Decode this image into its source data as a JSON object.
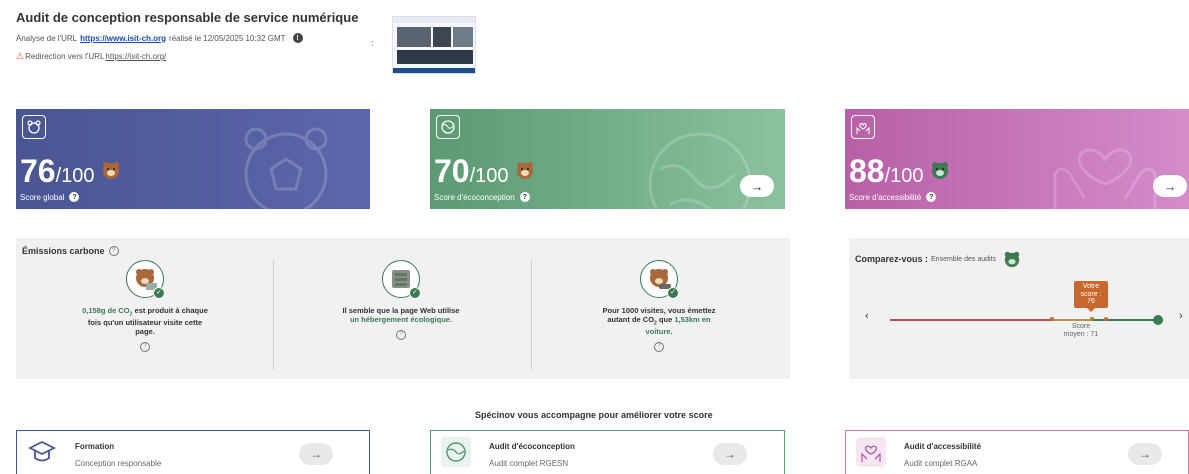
{
  "header": {
    "title": "Audit de conception responsable de service numérique",
    "meta_prefix": "Analyse de l'URL",
    "url": "https://www.isit-ch.org",
    "meta_suffix": "réalisé le 12/05/2025 10:32 GMT",
    "info_glyph": "!",
    "redirect_prefix": "Redirection vers l'URL",
    "redirect_url": "https://isit-ch.org/",
    "warning_glyph": "⚠",
    "more_glyph": ":"
  },
  "cards": {
    "global": {
      "score": "76",
      "max": "/100",
      "label": "Score global",
      "icon": "beaver-face-icon"
    },
    "eco": {
      "score": "70",
      "max": "/100",
      "label": "Score d'écoconception",
      "icon": "globe-icon"
    },
    "access": {
      "score": "88",
      "max": "/100",
      "label": "Score d'accessibilité",
      "icon": "heart-hands-icon"
    },
    "help_glyph": "?"
  },
  "emissions": {
    "title": "Émissions carbone",
    "help_glyph": "?",
    "col1": {
      "line1": "0,158g de CO",
      "sub": "2",
      "line1b": " est produit à chaque",
      "line2": "fois qu'un utilisateur visite cette",
      "line3": "page."
    },
    "col2": {
      "line1": "Il semble que la page Web utilise",
      "line2": "un hébergement écologique."
    },
    "col3": {
      "line1": "Pour 1000 visites, vous émettez",
      "line2a": "autant de CO",
      "sub": "2",
      "line2b": " que ",
      "line2c": "1,53km en",
      "line3": "voiture."
    }
  },
  "compare": {
    "title": "Comparez-vous :",
    "subtitle": "Ensemble des audits",
    "votre_line1": "Votre",
    "votre_line2": "score :",
    "votre_value": "76",
    "moyen_line1": "Score",
    "moyen_line2": "moyen : 71",
    "prev_glyph": "‹",
    "next_glyph": "›"
  },
  "accompany": {
    "title": "Spécinov vous accompagne pour améliorer votre score",
    "items": [
      {
        "title": "Formation",
        "subtitle": "Conception responsable"
      },
      {
        "title": "Audit d'écoconception",
        "subtitle": "Audit complet RGESN"
      },
      {
        "title": "Audit d'accessibilité",
        "subtitle": "Audit complet RGAA"
      }
    ],
    "arrow_glyph": "→"
  },
  "colors": {
    "global": "#4a5593",
    "eco": "#5b9a73",
    "access": "#b85fa8",
    "brand_green": "#3c7a52",
    "bear_brown": "#a8683a"
  }
}
